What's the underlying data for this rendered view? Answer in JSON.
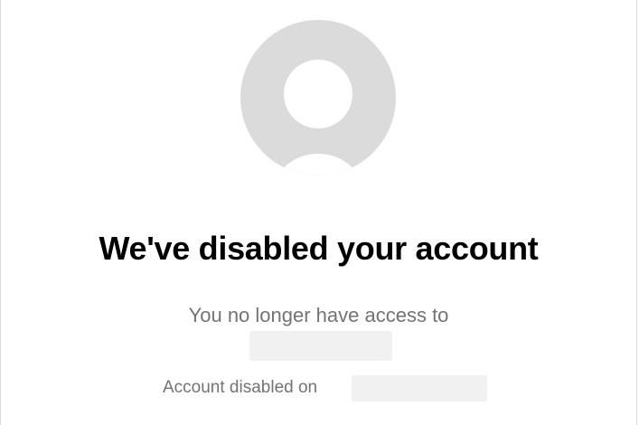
{
  "dialog": {
    "avatar_icon": "user-silhouette-icon",
    "title": "We've disabled your account",
    "access_message": "You no longer have access to",
    "disabled_label": "Account disabled on"
  },
  "colors": {
    "title": "#000000",
    "secondary_text": "#737373",
    "avatar_bg": "#dbdbdb",
    "redaction": "#f1f1f1",
    "border": "#dbdbdb"
  }
}
